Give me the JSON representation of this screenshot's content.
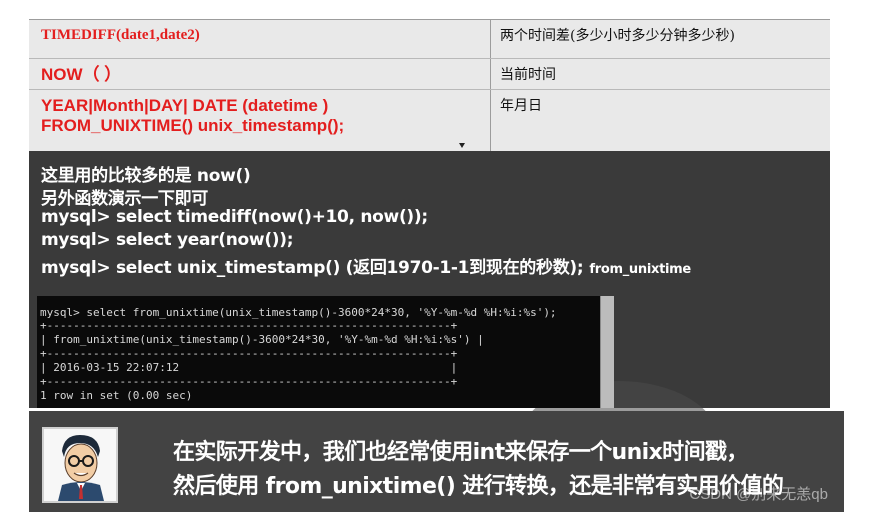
{
  "functions_table": {
    "rows": [
      {
        "function": "TIMEDIFF(date1,date2)",
        "description": "两个时间差(多少小时多少分钟多少秒)"
      },
      {
        "function": "NOW（ ）",
        "description": "当前时间"
      },
      {
        "function_lines": [
          "YEAR|Month|DAY| DATE (datetime )",
          "FROM_UNIXTIME()  unix_timestamp();"
        ],
        "description": "年月日"
      }
    ]
  },
  "notes": {
    "line1": "这里用的比较多的是 now()",
    "line2": "另外函数演示一下即可",
    "line3": "mysql> select timediff(now()+10, now());",
    "line4": "mysql> select year(now());",
    "line5": "mysql> select unix_timestamp() (返回1970-1-1到现在的秒数);",
    "line5_small": "from_unixtime"
  },
  "console": {
    "lines": [
      "mysql> select from_unixtime(unix_timestamp()-3600*24*30, '%Y-%m-%d %H:%i:%s');",
      "+-------------------------------------------------------------+",
      "| from_unixtime(unix_timestamp()-3600*24*30, '%Y-%m-%d %H:%i:%s') |",
      "+-------------------------------------------------------------+",
      "| 2016-03-15 22:07:12                                         |",
      "+-------------------------------------------------------------+",
      "1 row in set (0.00 sec)"
    ]
  },
  "banner": {
    "line1": "在实际开发中，我们也经常使用int来保存一个unix时间戳，",
    "line2": "然后使用 from_unixtime() 进行转换，还是非常有实用价值的",
    "credit": "CSDN @别来无恙qb",
    "avatar_icon": "cartoon-teacher-avatar"
  },
  "colors": {
    "function_red": "#e31e1e",
    "table_bg": "#e9e9e9",
    "notes_bg": "#3a3a3a",
    "banner_bg": "#434343"
  }
}
